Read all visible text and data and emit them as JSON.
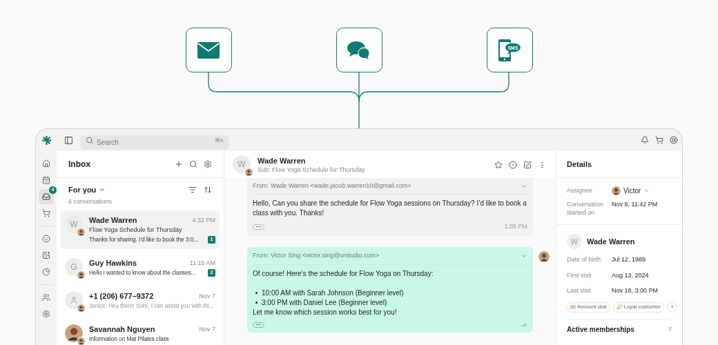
{
  "channels": [
    {
      "kind": "email"
    },
    {
      "kind": "chat"
    },
    {
      "kind": "sms",
      "label": "SMS"
    }
  ],
  "topbar": {
    "search": {
      "placeholder": "Search",
      "shortcut": "⌘K"
    }
  },
  "rail": [
    {
      "items": [
        {
          "kind": "home",
          "selected": false
        },
        {
          "kind": "calendar",
          "selected": false
        },
        {
          "kind": "inbox",
          "selected": true,
          "badge": "4"
        },
        {
          "kind": "cart",
          "selected": false
        }
      ]
    },
    {
      "items": [
        {
          "kind": "smile",
          "selected": false
        },
        {
          "kind": "image",
          "selected": false
        },
        {
          "kind": "chart",
          "selected": false
        }
      ]
    },
    {
      "items": [
        {
          "kind": "users",
          "selected": false
        },
        {
          "kind": "settings",
          "selected": false
        }
      ]
    }
  ],
  "inbox": {
    "title": "Inbox",
    "filter": "For you",
    "count": "6 conversations",
    "conversations": [
      {
        "avatar": {
          "kind": "letter",
          "letter": "W"
        },
        "name": "Wade Warren",
        "time": "4:32 PM",
        "subject": "Flow Yoga Schedule for Thursday",
        "preview": "Thanks for sharing. I’d like to book the 3:0...",
        "unread": true,
        "count": "1",
        "selected": true
      },
      {
        "avatar": {
          "kind": "letter",
          "letter": "G"
        },
        "name": "Guy Hawkins",
        "time": "11:15 AM",
        "preview": "Hello i wanted to know about the classes...",
        "unread": true,
        "count": "2",
        "selected": false
      },
      {
        "avatar": {
          "kind": "icon"
        },
        "name": "+1 (206) 677–9372",
        "time": "Nov 7",
        "preview": "Janice: Hey there! Sure, I can assist you with thi...",
        "unread": false,
        "selected": false
      },
      {
        "avatar": {
          "kind": "photo"
        },
        "name": "Savannah Nguyen",
        "time": "Nov 7",
        "preview": "Information on Mat Pilates class",
        "unread": true,
        "selected": false
      }
    ]
  },
  "conversation": {
    "avatar_letter": "W",
    "name": "Wade Warren",
    "subject": "Sub: Flow Yoga Schedule for Thursday",
    "messages": [
      {
        "kind": "incoming",
        "from": "From: Wade Warren <wade.jacob.warren10@gmail.com>",
        "intro": "Hello, Can you share the schedule for Flow Yoga sessions on Thursday? I’d like to book a class with you. Thanks!",
        "time": "1:05 PM"
      },
      {
        "kind": "outgoing",
        "from": "From: Victor Sing <victor.sing@urstudio.com>",
        "intro": "Of course! Here’s the schedule for Flow Yoga on Thursday:",
        "items": [
          "10:00 AM with Sarah Johnson (Beginner level)",
          "3:00 PM with Daniel Lee (Beginner level)"
        ],
        "outro": "Let me know which session works best for you!"
      }
    ]
  },
  "details": {
    "title": "Details",
    "assignee_label": "Assignee",
    "assignee": "Victor",
    "started_label": "Conversation started on",
    "started": "Nov 8, 11:42 PM",
    "contact": {
      "letter": "W",
      "name": "Wade Warren",
      "fields": [
        {
          "label": "Date of birth",
          "value": "Jul 12, 1989"
        },
        {
          "label": "First visit",
          "value": "Aug 13, 2024"
        },
        {
          "label": "Last visit",
          "value": "Nov 18, 3:00 PM"
        }
      ]
    },
    "tags": [
      {
        "kind": "amount",
        "label": "Amount due"
      },
      {
        "kind": "loyal",
        "label": "Loyal customer"
      },
      {
        "kind": "more",
        "label": "+"
      }
    ],
    "memberships": {
      "label": "Active memberships",
      "count": "2"
    }
  }
}
